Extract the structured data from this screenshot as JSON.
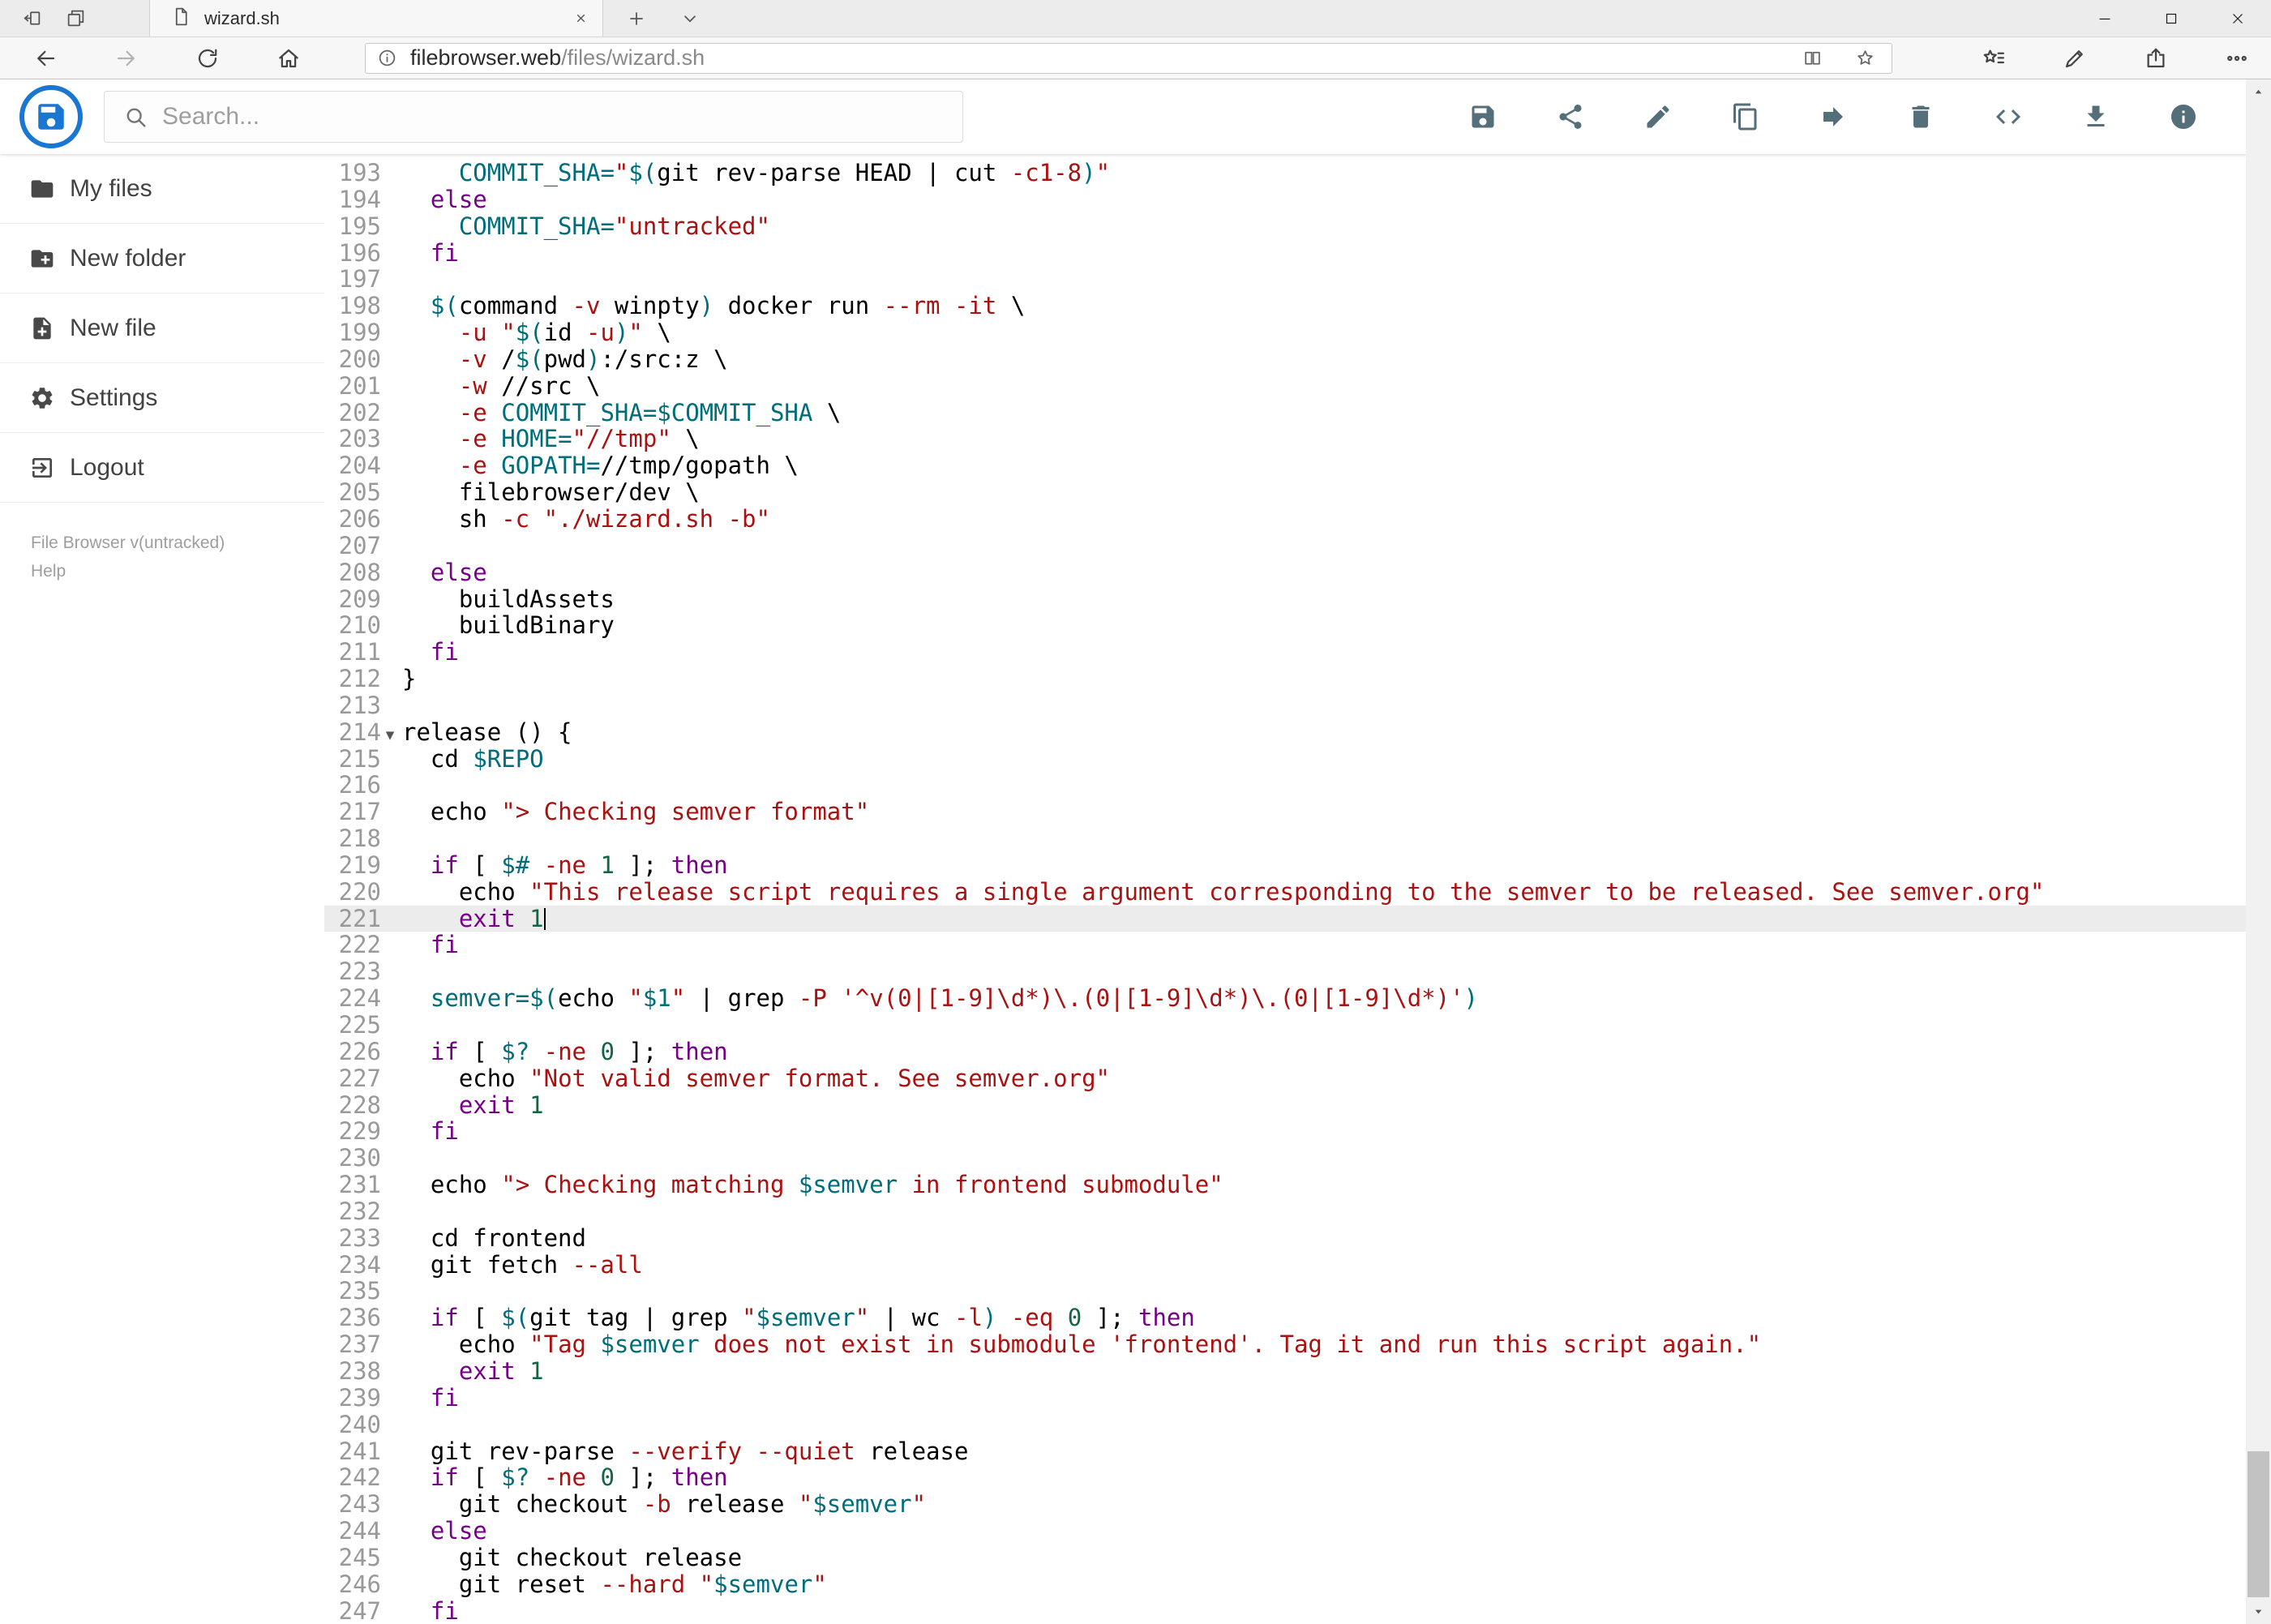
{
  "colors": {
    "accent_blue": "#1976d2",
    "toolbar_icon": "#546e7a",
    "active_line_bg": "#ececec",
    "syntax_keyword": "#770088",
    "syntax_string": "#aa1111",
    "syntax_variable": "#006e7a",
    "syntax_number": "#116644",
    "syntax_flag": "#aa1111"
  },
  "browser": {
    "tab_title": "wizard.sh",
    "url_domain": "filebrowser.web",
    "url_path": "/files/wizard.sh"
  },
  "app_header": {
    "search_placeholder": "Search...",
    "toolbar": [
      {
        "id": "save",
        "icon": "save-icon"
      },
      {
        "id": "share",
        "icon": "share-icon"
      },
      {
        "id": "rename",
        "icon": "pencil-icon"
      },
      {
        "id": "copy",
        "icon": "copy-icon"
      },
      {
        "id": "move",
        "icon": "move-arrow-icon"
      },
      {
        "id": "delete",
        "icon": "trash-icon"
      },
      {
        "id": "raw",
        "icon": "code-icon"
      },
      {
        "id": "download",
        "icon": "download-icon"
      },
      {
        "id": "info",
        "icon": "info-icon"
      }
    ]
  },
  "sidebar": {
    "items": [
      {
        "id": "my-files",
        "label": "My files",
        "icon": "folder-icon"
      },
      {
        "id": "new-folder",
        "label": "New folder",
        "icon": "new-folder-icon"
      },
      {
        "id": "new-file",
        "label": "New file",
        "icon": "new-file-icon"
      },
      {
        "id": "settings",
        "label": "Settings",
        "icon": "settings-gear-icon"
      },
      {
        "id": "logout",
        "label": "Logout",
        "icon": "logout-icon"
      }
    ],
    "version_text": "File Browser v(untracked)",
    "help_text": "Help"
  },
  "editor": {
    "first_line_number": 193,
    "active_line_number": 221,
    "cursor": {
      "line": 221,
      "column": 10
    },
    "fold_marker_line": 214,
    "syntax_keywords": [
      "if",
      "then",
      "elif",
      "else",
      "fi",
      "for",
      "in",
      "do",
      "done",
      "while",
      "until",
      "case",
      "esac",
      "function",
      "exit",
      "set",
      "unset",
      "export"
    ],
    "lines": [
      "    COMMIT_SHA=\"$(git rev-parse HEAD | cut -c1-8)\"",
      "  else",
      "    COMMIT_SHA=\"untracked\"",
      "  fi",
      "",
      "  $(command -v winpty) docker run --rm -it \\",
      "    -u \"$(id -u)\" \\",
      "    -v /$(pwd):/src:z \\",
      "    -w //src \\",
      "    -e COMMIT_SHA=$COMMIT_SHA \\",
      "    -e HOME=\"//tmp\" \\",
      "    -e GOPATH=//tmp/gopath \\",
      "    filebrowser/dev \\",
      "    sh -c \"./wizard.sh -b\"",
      "",
      "  else",
      "    buildAssets",
      "    buildBinary",
      "  fi",
      "}",
      "",
      "release () {",
      "  cd $REPO",
      "",
      "  echo \"> Checking semver format\"",
      "",
      "  if [ $# -ne 1 ]; then",
      "    echo \"This release script requires a single argument corresponding to the semver to be released. See semver.org\"",
      "    exit 1",
      "  fi",
      "",
      "  semver=$(echo \"$1\" | grep -P '^v(0|[1-9]\\d*)\\.(0|[1-9]\\d*)\\.(0|[1-9]\\d*)')",
      "",
      "  if [ $? -ne 0 ]; then",
      "    echo \"Not valid semver format. See semver.org\"",
      "    exit 1",
      "  fi",
      "",
      "  echo \"> Checking matching $semver in frontend submodule\"",
      "",
      "  cd frontend",
      "  git fetch --all",
      "",
      "  if [ $(git tag | grep \"$semver\" | wc -l) -eq 0 ]; then",
      "    echo \"Tag $semver does not exist in submodule 'frontend'. Tag it and run this script again.\"",
      "    exit 1",
      "  fi",
      "",
      "  git rev-parse --verify --quiet release",
      "  if [ $? -ne 0 ]; then",
      "    git checkout -b release \"$semver\"",
      "  else",
      "    git checkout release",
      "    git reset --hard \"$semver\"",
      "  fi"
    ]
  }
}
